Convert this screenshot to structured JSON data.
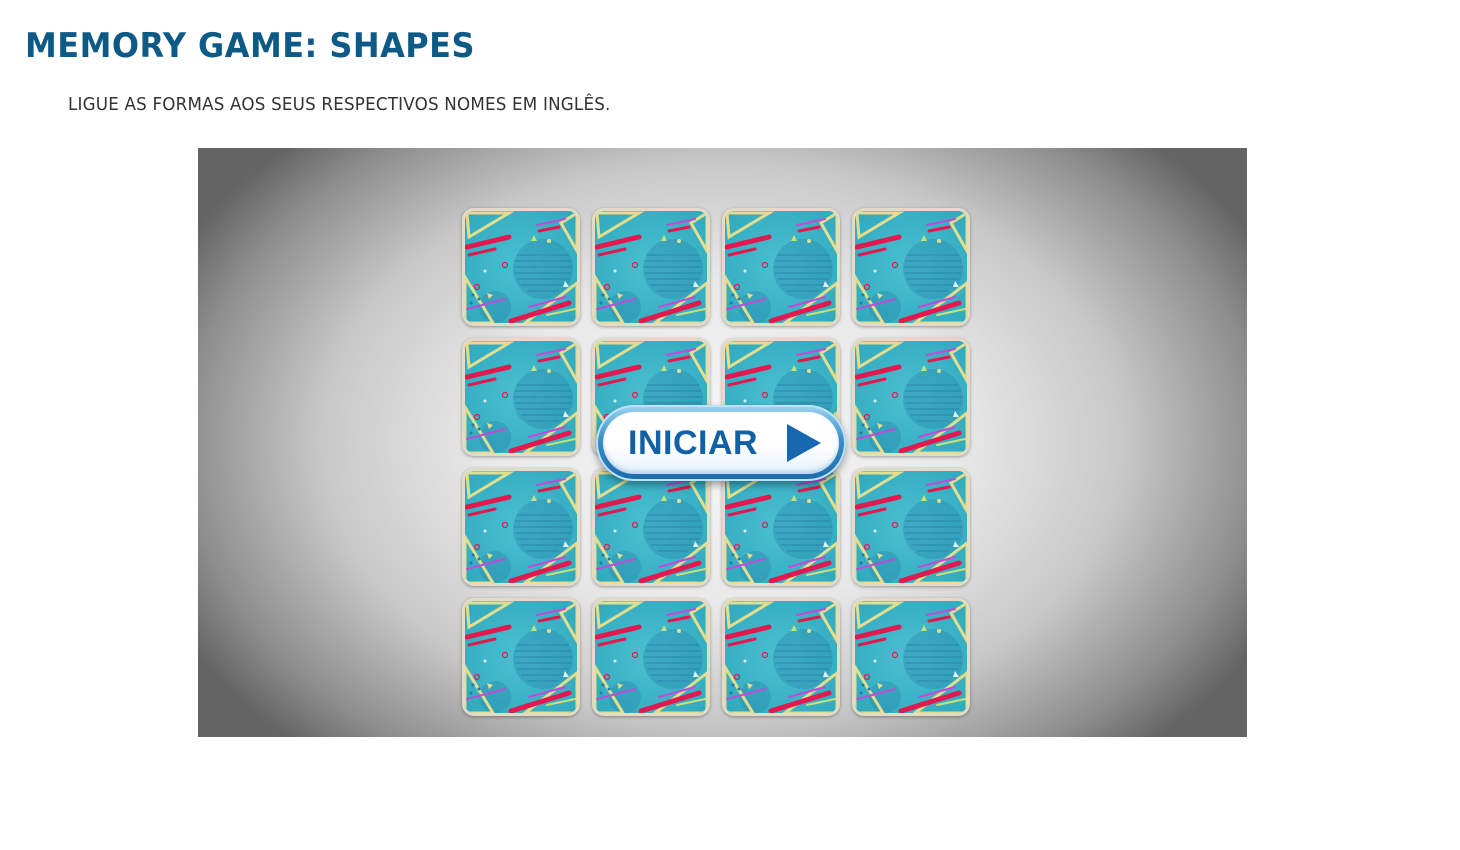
{
  "header": {
    "title": "MEMORY GAME: SHAPES",
    "instructions": "LIGUE AS FORMAS AOS SEUS RESPECTIVOS NOMES EM INGLÊS."
  },
  "game": {
    "grid": {
      "rows": 4,
      "columns": 4,
      "card_count": 16
    },
    "cards": [
      {
        "state": "face-down"
      },
      {
        "state": "face-down"
      },
      {
        "state": "face-down"
      },
      {
        "state": "face-down"
      },
      {
        "state": "face-down"
      },
      {
        "state": "face-down"
      },
      {
        "state": "face-down"
      },
      {
        "state": "face-down"
      },
      {
        "state": "face-down"
      },
      {
        "state": "face-down"
      },
      {
        "state": "face-down"
      },
      {
        "state": "face-down"
      },
      {
        "state": "face-down"
      },
      {
        "state": "face-down"
      },
      {
        "state": "face-down"
      },
      {
        "state": "face-down"
      }
    ],
    "start_button": {
      "label": "INICIAR",
      "icon": "play-icon"
    }
  },
  "colors": {
    "title": "#0d5a86",
    "card_back": "#3fb2c6",
    "card_stripe_red": "#e2194f",
    "card_stripe_purple": "#c24ad8",
    "card_triangle": "#e3dd8c",
    "button_text": "#1260a6"
  }
}
